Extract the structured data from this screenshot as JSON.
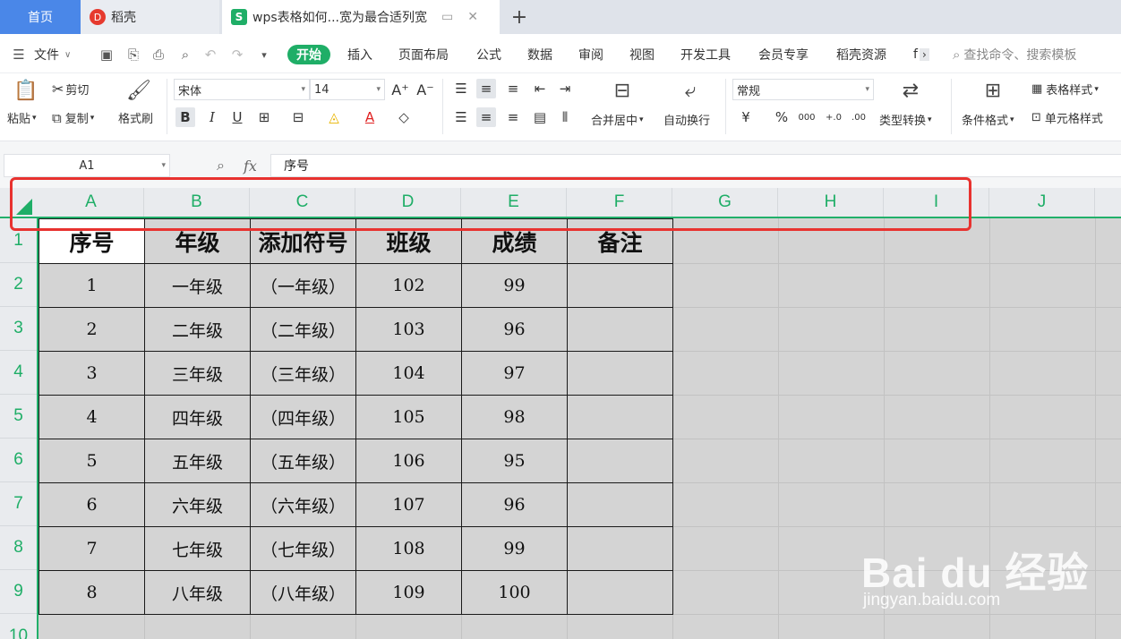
{
  "tabs": {
    "home": "首页",
    "daoke": "稻壳",
    "doc_title": "wps表格如何...宽为最合适列宽",
    "add": "+"
  },
  "menu": {
    "file": "文件",
    "items": [
      "开始",
      "插入",
      "页面布局",
      "公式",
      "数据",
      "审阅",
      "视图",
      "开发工具",
      "会员专享",
      "稻壳资源",
      "f"
    ],
    "search_placeholder": "查找命令、搜索模板"
  },
  "ribbon": {
    "paste": "粘贴",
    "cut": "剪切",
    "copy": "复制",
    "format_painter": "格式刷",
    "font_name": "宋体",
    "font_size": "14",
    "merge_center": "合并居中",
    "auto_wrap": "自动换行",
    "number_format": "常规",
    "type_convert": "类型转换",
    "cond_format": "条件格式",
    "table_style": "表格样式",
    "cell_style": "单元格样式",
    "bold": "B",
    "italic": "I",
    "underline": "U",
    "font_color": "A",
    "currency": "¥",
    "percent": "%",
    "thousands": "000",
    "dec_inc": "+.0",
    "dec_dec": ".00"
  },
  "formula_bar": {
    "cell_ref": "A1",
    "fx": "fx",
    "content": "序号"
  },
  "columns": [
    "A",
    "B",
    "C",
    "D",
    "E",
    "F",
    "G",
    "H",
    "I",
    "J"
  ],
  "rows": [
    "1",
    "2",
    "3",
    "4",
    "5",
    "6",
    "7",
    "8",
    "9",
    "10"
  ],
  "table": {
    "headers": [
      "序号",
      "年级",
      "添加符号",
      "班级",
      "成绩",
      "备注"
    ],
    "rows": [
      [
        "1",
        "一年级",
        "（一年级）",
        "102",
        "99",
        ""
      ],
      [
        "2",
        "二年级",
        "（二年级）",
        "103",
        "96",
        ""
      ],
      [
        "3",
        "三年级",
        "（三年级）",
        "104",
        "97",
        ""
      ],
      [
        "4",
        "四年级",
        "（四年级）",
        "105",
        "98",
        ""
      ],
      [
        "5",
        "五年级",
        "（五年级）",
        "106",
        "95",
        ""
      ],
      [
        "6",
        "六年级",
        "（六年级）",
        "107",
        "96",
        ""
      ],
      [
        "7",
        "七年级",
        "（七年级）",
        "108",
        "99",
        ""
      ],
      [
        "8",
        "八年级",
        "（八年级）",
        "109",
        "100",
        ""
      ]
    ]
  },
  "watermark": {
    "brand": "Bai du 经验",
    "url": "jingyan.baidu.com"
  },
  "colors": {
    "accent_green": "#1fae67",
    "tab_blue": "#4a87e8",
    "highlight_red": "#e8322f",
    "cell_gray": "#d4d4d4"
  }
}
